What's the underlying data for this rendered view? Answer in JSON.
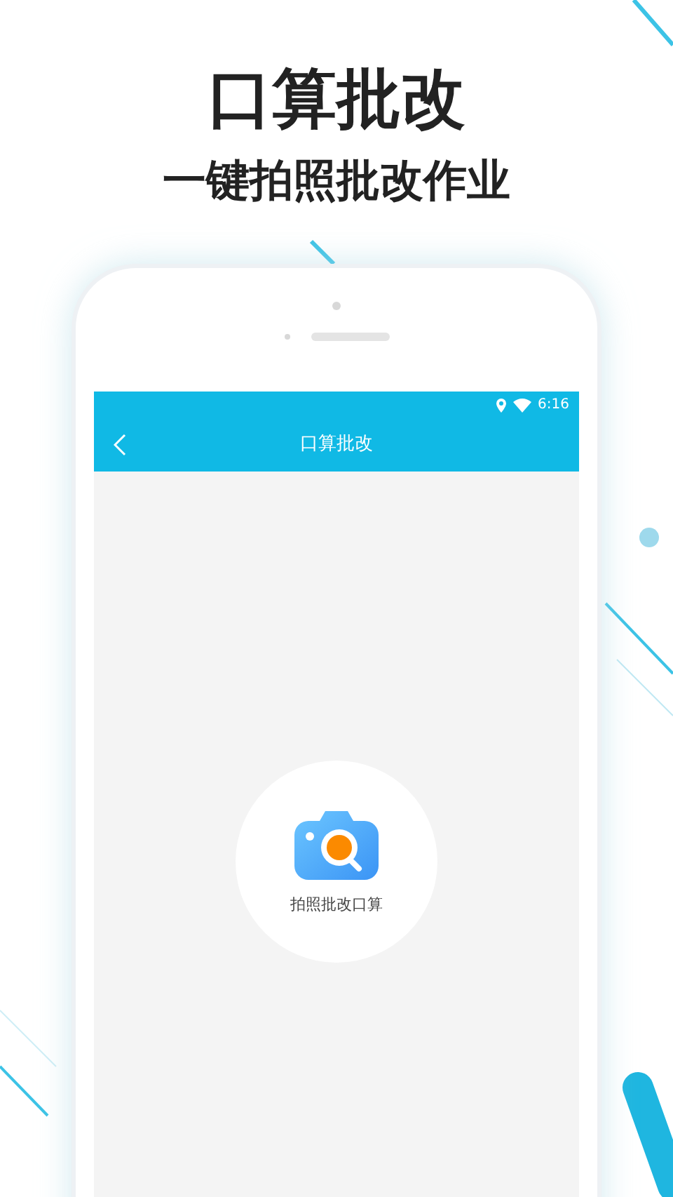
{
  "promo": {
    "title": "口算批改",
    "subtitle": "一键拍照批改作业"
  },
  "status_bar": {
    "time": "6:16"
  },
  "nav_bar": {
    "title": "口算批改"
  },
  "camera_button": {
    "label": "拍照批改口算"
  }
}
